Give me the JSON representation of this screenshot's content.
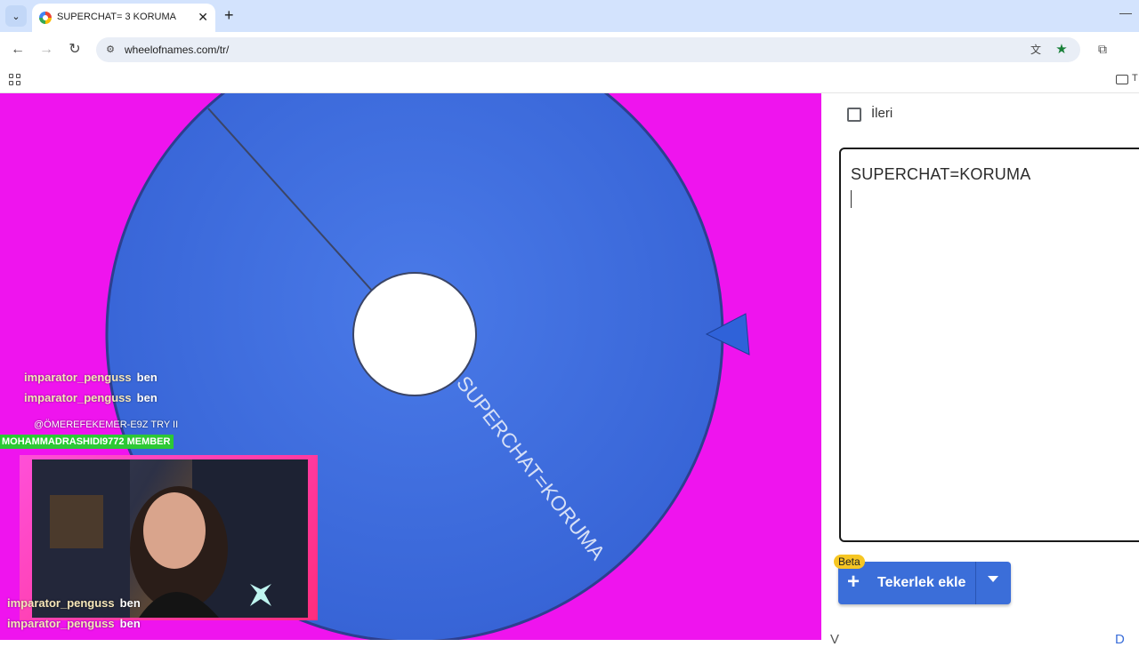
{
  "browser": {
    "tab_title": "SUPERCHAT= 3 KORUMA",
    "url": "wheelofnames.com/tr/",
    "new_tab_label": "+",
    "close_label": "✕",
    "bookmarks_folder_text": "T"
  },
  "wheel": {
    "segment_label": "SUPERCHAT=KORUMA",
    "color": "#3d6fe0",
    "background": "#ef14ee"
  },
  "sidebar": {
    "checkbox_label": "İleri",
    "entries": [
      "SUPERCHAT=KORUMA"
    ],
    "beta_badge": "Beta",
    "add_wheel_label": "Tekerlek ekle",
    "bottom_cut_text": "V",
    "bottom_cut_right": "D"
  },
  "chat": {
    "lines_top": [
      {
        "user": "imparator_penguss",
        "msg": "ben"
      },
      {
        "user": "imparator_penguss",
        "msg": "ben"
      }
    ],
    "sub_line": "@ÖMEREFEKEMER-E9Z  TRY II",
    "member_line": "MOHAMMADRASHIDI9772  MEMBER",
    "lines_bottom": [
      {
        "user": "imparator_penguss",
        "msg": "ben"
      },
      {
        "user": "imparator_penguss",
        "msg": "ben"
      }
    ]
  }
}
